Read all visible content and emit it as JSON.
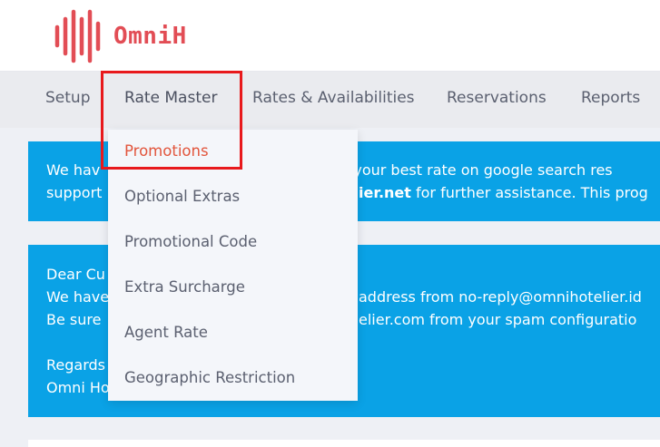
{
  "brand": {
    "name": "OmniH"
  },
  "colors": {
    "brand": "#e24d55",
    "info_box": "#0aa2e6",
    "active_menu_item": "#e2553c",
    "highlight": "#e8191c"
  },
  "nav": {
    "items": [
      "Setup",
      "Rate Master",
      "Rates & Availabilities",
      "Reservations",
      "Reports"
    ],
    "active": "Rate Master"
  },
  "dropdown": {
    "items": [
      "Promotions",
      "Optional Extras",
      "Promotional Code",
      "Extra Surcharge",
      "Agent Rate",
      "Geographic Restriction"
    ],
    "active": "Promotions"
  },
  "notice1": {
    "line1_left": "We hav",
    "line1_right": "ay your best rate on google search res",
    "line2_left": "support",
    "line2_bold": "ier.net",
    "line2_right": " for further assistance. This prog"
  },
  "notice2": {
    "line1": "Dear Cu",
    "line2_left": "We have",
    "line2_right": "address from no-reply@omnihotelier.id",
    "line3_left": "Be sure",
    "line3_right": "elier.com from your spam configuratio",
    "line4": "Regards",
    "line5": "Omni Ho"
  }
}
